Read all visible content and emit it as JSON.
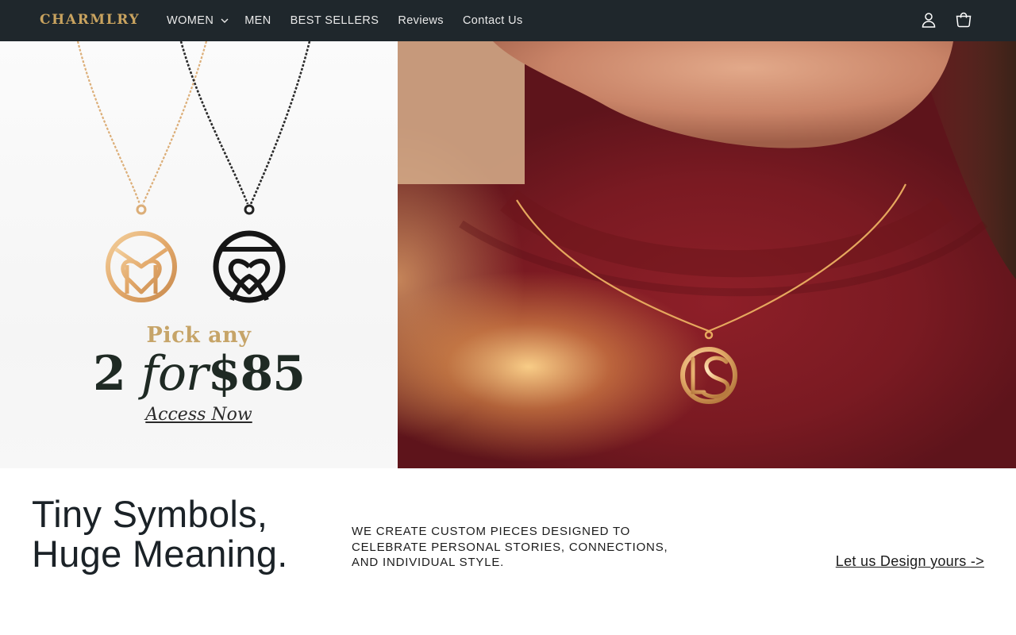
{
  "header": {
    "logo": "CHARMLRY",
    "nav": [
      {
        "label": "WOMEN",
        "has_dropdown": true
      },
      {
        "label": "MEN"
      },
      {
        "label": "BEST SELLERS"
      },
      {
        "label": "Reviews"
      },
      {
        "label": "Contact Us"
      }
    ],
    "icons": [
      "account-icon",
      "cart-icon"
    ]
  },
  "hero": {
    "promo": {
      "line1": "Pick any",
      "deal_number": "2",
      "deal_for": "for",
      "deal_price": "$85",
      "link": "Access Now"
    }
  },
  "section": {
    "headline_line1": "Tiny Symbols,",
    "headline_line2": "Huge Meaning.",
    "tagline": "WE CREATE CUSTOM PIECES DESIGNED TO CELEBRATE PERSONAL STORIES, CONNECTIONS, AND INDIVIDUAL STYLE.",
    "cta": "Let us Design yours ->"
  },
  "colors": {
    "header_bg": "#1f272c",
    "logo_gold": "#c9a35f",
    "burgundy": "#7a1a22",
    "promo_gold": "#c6a468"
  }
}
